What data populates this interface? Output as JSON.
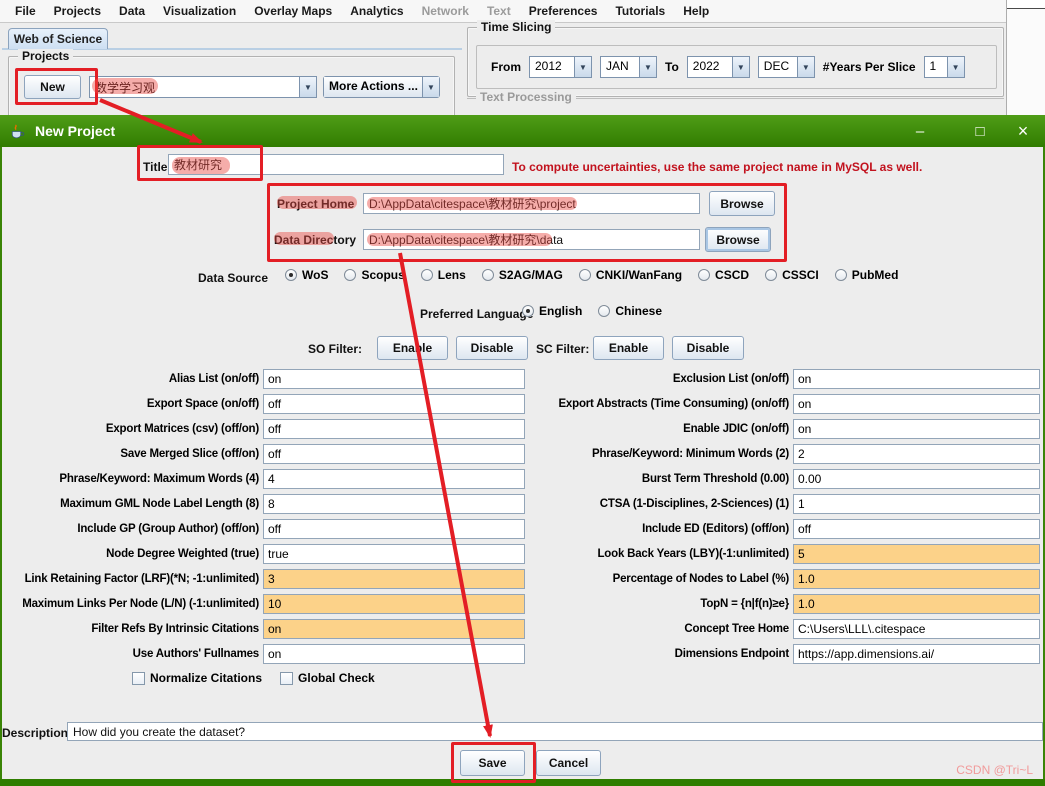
{
  "app": {
    "watermark": "CSDN @Tri~L",
    "accent_green": "#3a8406",
    "annotation_red": "#e31e25",
    "highlight_orange": "#fcd289"
  },
  "menu_bar": {
    "items": [
      {
        "label": "File",
        "enabled": true
      },
      {
        "label": "Projects",
        "enabled": true
      },
      {
        "label": "Data",
        "enabled": true
      },
      {
        "label": "Visualization",
        "enabled": true
      },
      {
        "label": "Overlay Maps",
        "enabled": true
      },
      {
        "label": "Analytics",
        "enabled": true
      },
      {
        "label": "Network",
        "enabled": false
      },
      {
        "label": "Text",
        "enabled": false
      },
      {
        "label": "Preferences",
        "enabled": true
      },
      {
        "label": "Tutorials",
        "enabled": true
      },
      {
        "label": "Help",
        "enabled": true
      }
    ]
  },
  "main_window": {
    "tab_label": "Web of Science",
    "projects_group": {
      "title": "Projects",
      "new_button": "New",
      "selected_project": "数学学习观",
      "more_actions": "More Actions ..."
    },
    "time_slicing": {
      "title": "Time Slicing",
      "from_label": "From",
      "from_year": "2012",
      "from_month": "JAN",
      "to_label": "To",
      "to_year": "2022",
      "to_month": "DEC",
      "years_per_slice_label": "#Years Per Slice",
      "years_per_slice": "1"
    },
    "text_processing_title": "Text Processing"
  },
  "dialog": {
    "title": "New Project",
    "window_buttons": {
      "minimize": "–",
      "maximize": "□",
      "close": "×"
    },
    "title_row": {
      "label": "Title",
      "value": "教材研究",
      "note": "To compute uncertainties, use the same project name in MySQL as well."
    },
    "project_home": {
      "label": "Project Home",
      "value": "D:\\AppData\\citespace\\教材研究\\project",
      "browse": "Browse"
    },
    "data_directory": {
      "label": "Data Directory",
      "value": "D:\\AppData\\citespace\\教材研究\\data",
      "browse": "Browse"
    },
    "data_source": {
      "label": "Data Source",
      "options": [
        "WoS",
        "Scopus",
        "Lens",
        "S2AG/MAG",
        "CNKI/WanFang",
        "CSCD",
        "CSSCI",
        "PubMed"
      ],
      "selected": "WoS"
    },
    "preferred_language": {
      "label": "Preferred Language",
      "options": [
        "English",
        "Chinese"
      ],
      "selected": "English"
    },
    "so_filter": {
      "label": "SO Filter:",
      "enable": "Enable",
      "disable": "Disable"
    },
    "sc_filter": {
      "label": "SC Filter:",
      "enable": "Enable",
      "disable": "Disable"
    },
    "left_fields": [
      {
        "label": "Alias List (on/off)",
        "value": "on",
        "highlight": false
      },
      {
        "label": "Export Space (on/off)",
        "value": "off",
        "highlight": false
      },
      {
        "label": "Export Matrices (csv) (off/on)",
        "value": "off",
        "highlight": false
      },
      {
        "label": "Save Merged Slice (off/on)",
        "value": "off",
        "highlight": false
      },
      {
        "label": "Phrase/Keyword: Maximum Words (4)",
        "value": "4",
        "highlight": false
      },
      {
        "label": "Maximum GML Node Label Length (8)",
        "value": "8",
        "highlight": false
      },
      {
        "label": "Include GP (Group Author) (off/on)",
        "value": "off",
        "highlight": false
      },
      {
        "label": "Node Degree Weighted (true)",
        "value": "true",
        "highlight": false
      },
      {
        "label": "Link Retaining Factor (LRF)(*N; -1:unlimited)",
        "value": "3",
        "highlight": true
      },
      {
        "label": "Maximum Links Per Node (L/N) (-1:unlimited)",
        "value": "10",
        "highlight": true
      },
      {
        "label": "Filter Refs By Intrinsic Citations",
        "value": "on",
        "highlight": true
      },
      {
        "label": "Use Authors' Fullnames",
        "value": "on",
        "highlight": false
      }
    ],
    "right_fields": [
      {
        "label": "Exclusion List (on/off)",
        "value": "on",
        "highlight": false
      },
      {
        "label": "Export Abstracts (Time Consuming) (on/off)",
        "value": "on",
        "highlight": false
      },
      {
        "label": "Enable JDIC (on/off)",
        "value": "on",
        "highlight": false
      },
      {
        "label": "Phrase/Keyword: Minimum Words (2)",
        "value": "2",
        "highlight": false
      },
      {
        "label": "Burst Term Threshold (0.00)",
        "value": "0.00",
        "highlight": false
      },
      {
        "label": "CTSA (1-Disciplines, 2-Sciences) (1)",
        "value": "1",
        "highlight": false
      },
      {
        "label": "Include ED (Editors) (off/on)",
        "value": "off",
        "highlight": false
      },
      {
        "label": "Look Back Years (LBY)(-1:unlimited)",
        "value": "5",
        "highlight": true
      },
      {
        "label": "Percentage of Nodes to Label (%)",
        "value": "1.0",
        "highlight": true
      },
      {
        "label": "TopN = {n|f(n)≥e}",
        "value": "1.0",
        "highlight": true
      },
      {
        "label": "Concept Tree Home",
        "value": "C:\\Users\\LLL\\.citespace",
        "highlight": false
      },
      {
        "label": "Dimensions Endpoint",
        "value": "https://app.dimensions.ai/",
        "highlight": false
      }
    ],
    "checkboxes": [
      {
        "label": "Normalize Citations",
        "checked": false
      },
      {
        "label": "Global Check",
        "checked": false
      }
    ],
    "description": {
      "label": "Description",
      "value": "How did you create the dataset?"
    },
    "buttons": {
      "save": "Save",
      "cancel": "Cancel"
    }
  }
}
